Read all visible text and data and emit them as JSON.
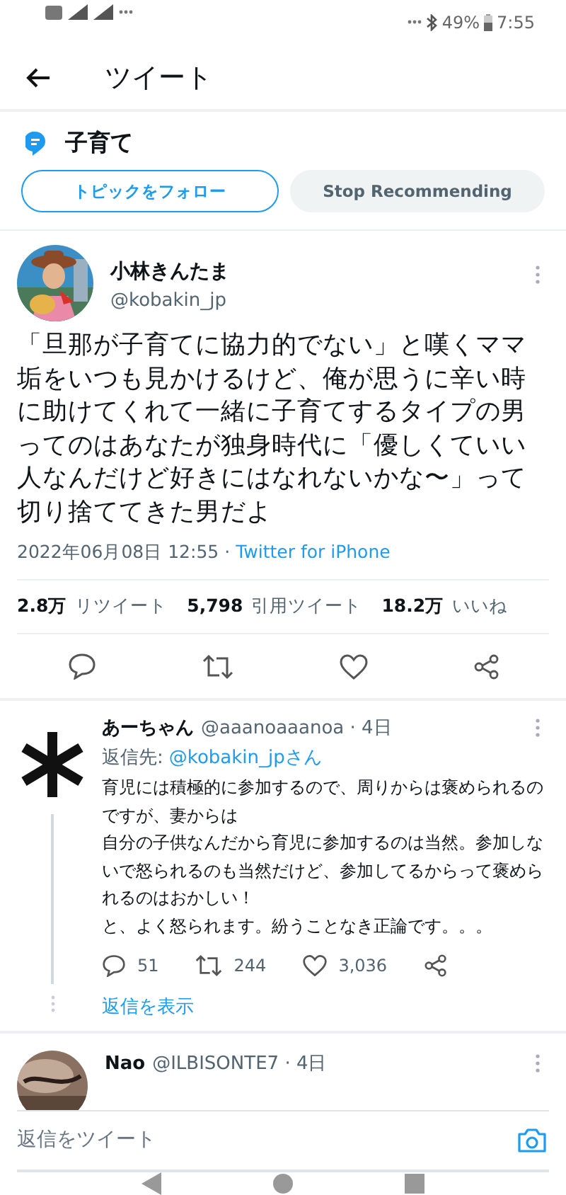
{
  "status_bar": {
    "battery": "49%",
    "time": "7:55"
  },
  "header": {
    "title": "ツイート"
  },
  "topic": {
    "name": "子育て",
    "follow_button": "トピックをフォロー",
    "stop_button": "Stop Recommending"
  },
  "tweet": {
    "name": "小林きんたま",
    "handle": "@kobakin_jp",
    "text": "「旦那が子育てに協力的でない」と嘆くママ垢をいつも見かけるけど、俺が思うに辛い時に助けてくれて一緒に子育てするタイプの男ってのはあなたが独身時代に「優しくていい人なんだけど好きにはなれないかな〜」って切り捨ててきた男だよ",
    "date": "2022年06月08日 12:55 ·",
    "source": "Twitter for iPhone",
    "stats": [
      {
        "count": "2.8万",
        "label": "リツイート"
      },
      {
        "count": "5,798",
        "label": "引用ツイート"
      },
      {
        "count": "18.2万",
        "label": "いいね"
      }
    ]
  },
  "replies": [
    {
      "name": "あーちゃん",
      "handle": "@aaanoaaanoa · 4日",
      "reply_to_label": "返信先:",
      "reply_to": "@kobakin_jpさん",
      "paragraphs": [
        "育児には積極的に参加するので、周りからは褒められるのですが、妻からは",
        "自分の子供なんだから育児に参加するのは当然。参加しないで怒られるのも当然だけど、参加してるからって褒められるのはおかしい！",
        "と、よく怒られます。紛うことなき正論です。。。"
      ],
      "replies": "51",
      "retweets": "244",
      "likes": "3,036",
      "show_replies": "返信を表示"
    },
    {
      "name": "Nao",
      "handle": "@ILBISONTE7 · 4日"
    }
  ],
  "reply_bar": {
    "placeholder": "返信をツイート"
  }
}
